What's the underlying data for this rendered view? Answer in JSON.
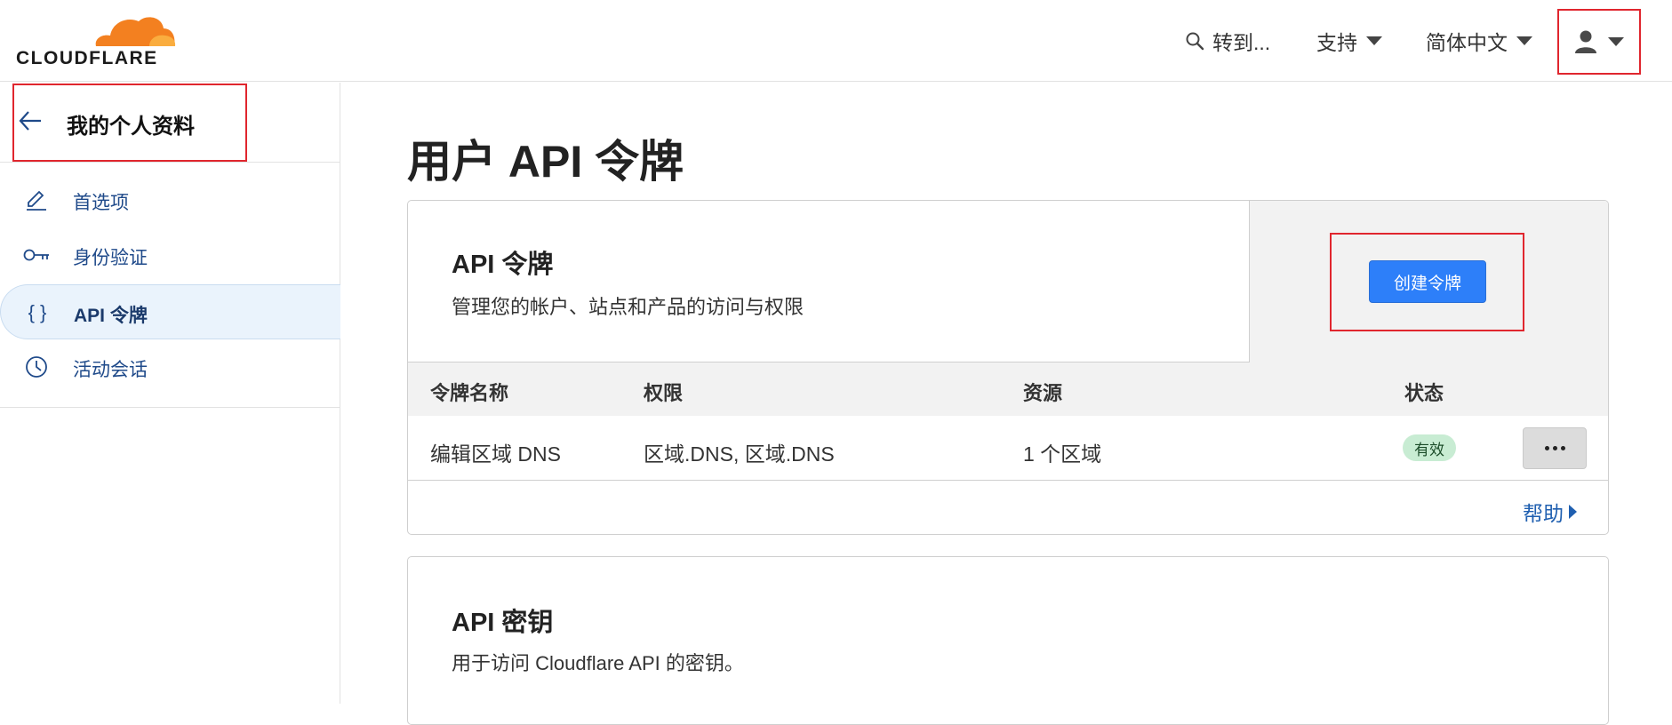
{
  "header": {
    "logo_text": "CLOUDFLARE",
    "search_label": "转到...",
    "support_label": "支持",
    "language_label": "简体中文"
  },
  "sidebar": {
    "back_title": "我的个人资料",
    "items": [
      {
        "label": "首选项",
        "icon": "pencil-icon"
      },
      {
        "label": "身份验证",
        "icon": "key-icon"
      },
      {
        "label": "API 令牌",
        "icon": "braces-icon",
        "active": true
      },
      {
        "label": "活动会话",
        "icon": "clock-icon"
      }
    ]
  },
  "main": {
    "page_title": "用户 API 令牌",
    "tokens_card": {
      "title": "API 令牌",
      "description": "管理您的帐户、站点和产品的访问与权限",
      "create_button": "创建令牌",
      "columns": [
        "令牌名称",
        "权限",
        "资源",
        "状态"
      ],
      "rows": [
        {
          "name": "编辑区域 DNS",
          "permissions": "区域.DNS, 区域.DNS",
          "resources": "1 个区域",
          "status": "有效"
        }
      ],
      "help_link": "帮助"
    },
    "keys_card": {
      "title": "API 密钥",
      "description": "用于访问 Cloudflare API 的密钥。"
    }
  },
  "colors": {
    "accent": "#2d7ff9",
    "highlight_border": "#e0262e",
    "logo_orange": "#f38020",
    "status_green_bg": "#c8ecd3"
  }
}
